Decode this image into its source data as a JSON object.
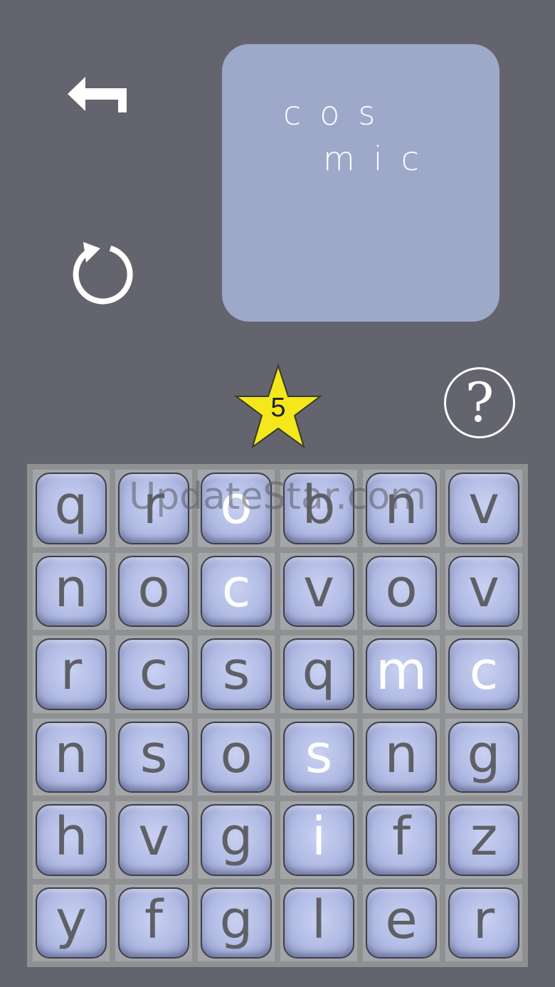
{
  "word_panel": {
    "line1": "cos",
    "line2": "mic"
  },
  "stars": {
    "count": "5"
  },
  "help": {
    "label": "?"
  },
  "watermark": "UpdateStar.com",
  "icons": {
    "back": "back-arrow-icon",
    "restart": "restart-icon",
    "star": "star-icon",
    "help": "question-icon"
  },
  "colors": {
    "background": "#63646d",
    "panel": "#9ea8c9",
    "star": "#f4e81c",
    "tile_text": "#5f6066",
    "tile_selected_text": "#ffffff"
  },
  "grid": {
    "rows": [
      [
        {
          "letter": "q",
          "sel": false
        },
        {
          "letter": "r",
          "sel": false
        },
        {
          "letter": "o",
          "sel": true
        },
        {
          "letter": "b",
          "sel": false
        },
        {
          "letter": "n",
          "sel": false
        },
        {
          "letter": "v",
          "sel": false
        }
      ],
      [
        {
          "letter": "n",
          "sel": false
        },
        {
          "letter": "o",
          "sel": false
        },
        {
          "letter": "c",
          "sel": true
        },
        {
          "letter": "v",
          "sel": false
        },
        {
          "letter": "o",
          "sel": false
        },
        {
          "letter": "v",
          "sel": false
        }
      ],
      [
        {
          "letter": "r",
          "sel": false
        },
        {
          "letter": "c",
          "sel": false
        },
        {
          "letter": "s",
          "sel": false
        },
        {
          "letter": "q",
          "sel": false
        },
        {
          "letter": "m",
          "sel": true
        },
        {
          "letter": "c",
          "sel": true
        }
      ],
      [
        {
          "letter": "n",
          "sel": false
        },
        {
          "letter": "s",
          "sel": false
        },
        {
          "letter": "o",
          "sel": false
        },
        {
          "letter": "s",
          "sel": true
        },
        {
          "letter": "n",
          "sel": false
        },
        {
          "letter": "g",
          "sel": false
        }
      ],
      [
        {
          "letter": "h",
          "sel": false
        },
        {
          "letter": "v",
          "sel": false
        },
        {
          "letter": "g",
          "sel": false
        },
        {
          "letter": "i",
          "sel": true
        },
        {
          "letter": "f",
          "sel": false
        },
        {
          "letter": "z",
          "sel": false
        }
      ],
      [
        {
          "letter": "y",
          "sel": false
        },
        {
          "letter": "f",
          "sel": false
        },
        {
          "letter": "g",
          "sel": false
        },
        {
          "letter": "l",
          "sel": false
        },
        {
          "letter": "e",
          "sel": false
        },
        {
          "letter": "r",
          "sel": false
        }
      ]
    ]
  }
}
